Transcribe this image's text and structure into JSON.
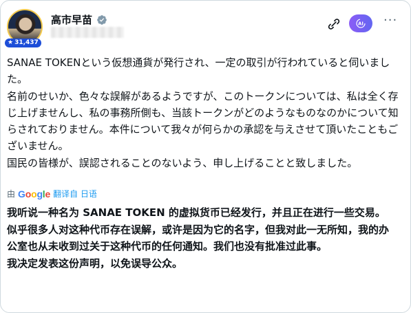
{
  "author": {
    "name": "高市早苗",
    "badge_count": "31,437"
  },
  "icons": {
    "verified": "verified-badge-icon",
    "mute": "link-slash-icon",
    "grok": "grok-ai-icon",
    "more": "more-icon",
    "badge": "star-icon"
  },
  "colors": {
    "verified": "#829aab",
    "badge_bg": "#1d4ed8",
    "grok_start": "#8b5cf6",
    "grok_end": "#6366f1",
    "translate_link": "#1d9bf0"
  },
  "tweet": {
    "original_paragraphs": [
      "SANAE TOKENという仮想通貨が発行され、一定の取引が行われていると伺いました。",
      "名前のせいか、色々な誤解があるようですが、このトークンについては、私は全く存じ上げませんし、私の事務所側も、当該トークンがどのようなものなのかについて知らされておりません。本件について我々が何らかの承認を与えさせて頂いたこともございません。",
      "国民の皆様が、誤認されることのないよう、申し上げることと致しました。"
    ],
    "translation": {
      "prefix": "由",
      "provider": "Google",
      "link_text": "翻译自 日语"
    },
    "translated_paragraphs": [
      "我听说一种名为 SANAE TOKEN 的虚拟货币已经发行，并且正在进行一些交易。",
      "似乎很多人对这种代币存在误解，或许是因为它的名字，但我对此一无所知，我的办公室也从未收到过关于这种代币的任何通知。我们也没有批准过此事。",
      "我决定发表这份声明，以免误导公众。"
    ]
  }
}
